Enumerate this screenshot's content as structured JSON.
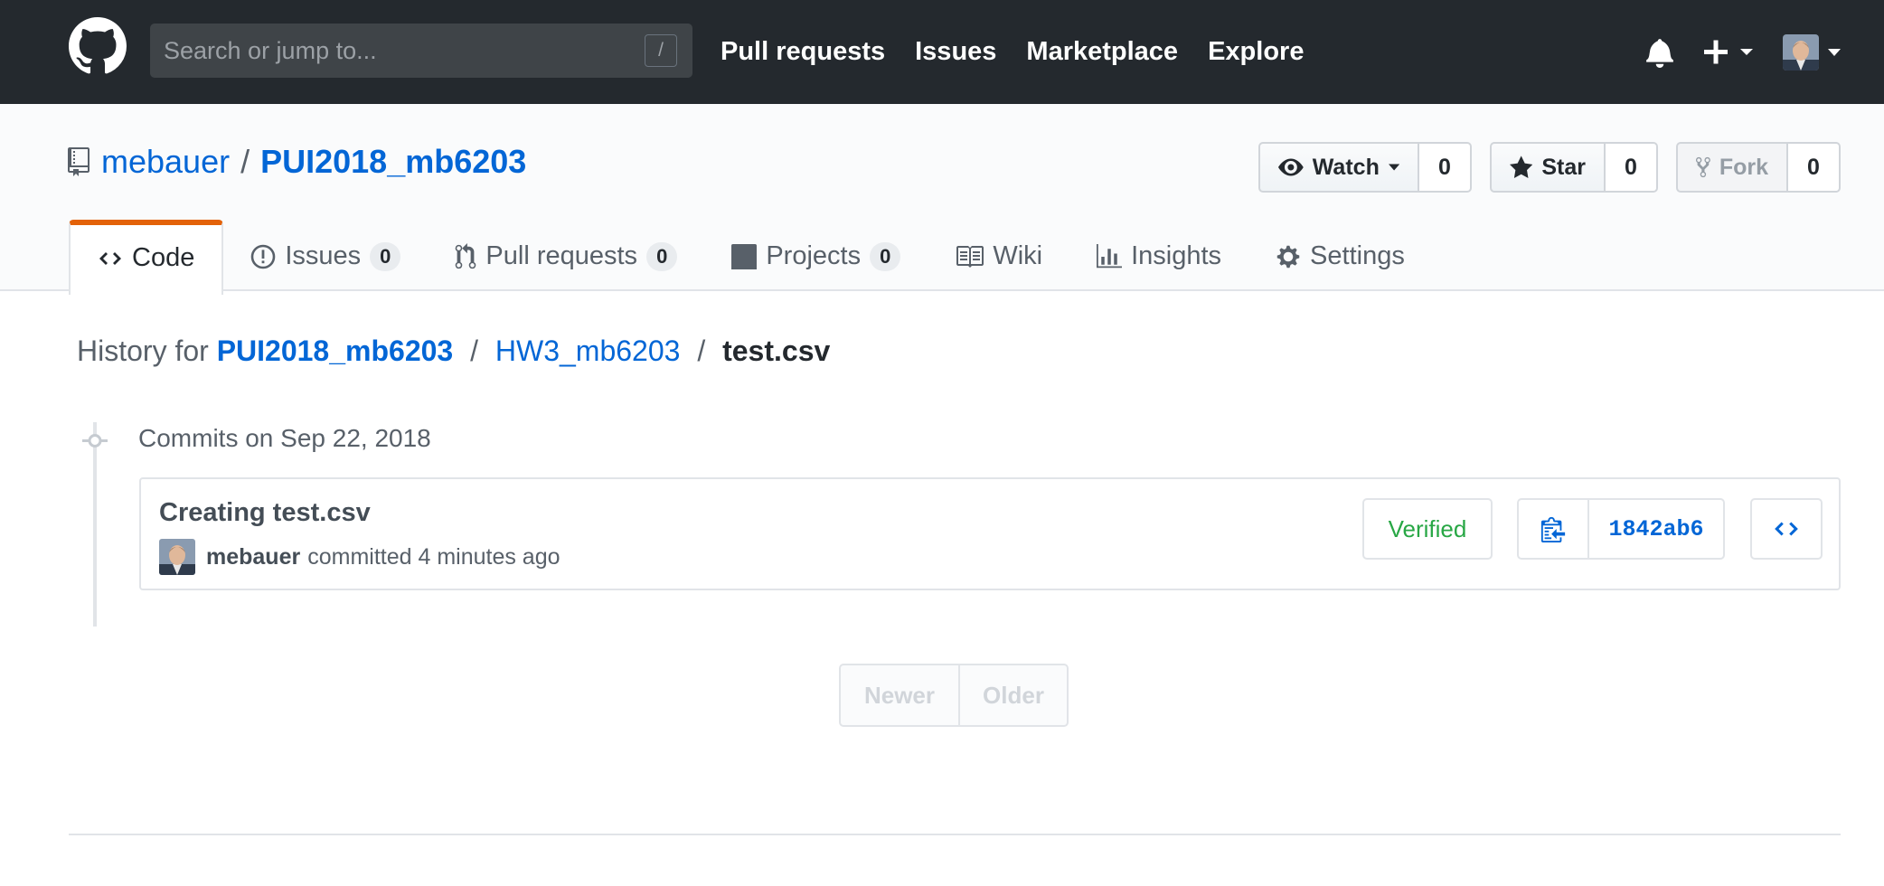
{
  "header": {
    "search_placeholder": "Search or jump to...",
    "search_shortcut": "/",
    "nav": [
      "Pull requests",
      "Issues",
      "Marketplace",
      "Explore"
    ]
  },
  "repo": {
    "owner": "mebauer",
    "name": "PUI2018_mb6203",
    "watch_label": "Watch",
    "watch_count": "0",
    "star_label": "Star",
    "star_count": "0",
    "fork_label": "Fork",
    "fork_count": "0"
  },
  "tabs": {
    "code": "Code",
    "issues": "Issues",
    "issues_count": "0",
    "pull_requests": "Pull requests",
    "pull_requests_count": "0",
    "projects": "Projects",
    "projects_count": "0",
    "wiki": "Wiki",
    "insights": "Insights",
    "settings": "Settings"
  },
  "history": {
    "prefix": "History for",
    "repo_link": "PUI2018_mb6203",
    "dir_link": "HW3_mb6203",
    "file": "test.csv",
    "separator": "/",
    "date_heading": "Commits on Sep 22, 2018"
  },
  "commit": {
    "title": "Creating test.csv",
    "author": "mebauer",
    "action": "committed 4 minutes ago",
    "verified": "Verified",
    "sha": "1842ab6"
  },
  "pagination": {
    "newer": "Newer",
    "older": "Older"
  },
  "colors": {
    "header_bg": "#24292e",
    "link": "#0366d6",
    "selected_tab_accent": "#e36209",
    "verified": "#28a745"
  }
}
